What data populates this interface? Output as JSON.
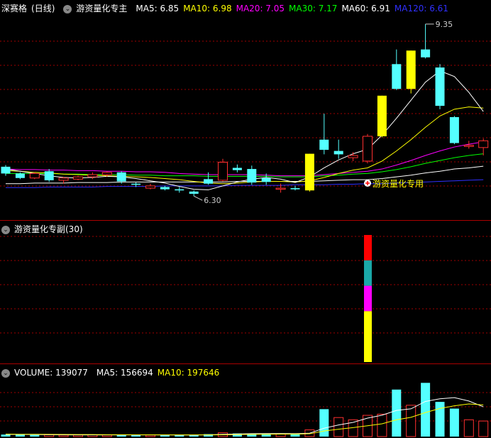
{
  "main_panel": {
    "stock_name": "深赛格",
    "period": "(日线)",
    "indicator_name": "游资量化专主",
    "ma": [
      {
        "label": "MA5: 6.85",
        "color": "#ffffff"
      },
      {
        "label": "MA10: 6.98",
        "color": "#ffff00"
      },
      {
        "label": "MA20: 7.05",
        "color": "#ff00ff"
      },
      {
        "label": "MA30: 7.17",
        "color": "#00ff00"
      },
      {
        "label": "MA60: 6.91",
        "color": "#ffffff"
      },
      {
        "label": "MA120: 6.61",
        "color": "#3030ff"
      }
    ],
    "high_label": "9.35",
    "low_label": "6.30",
    "signal_label": "游资量化专用"
  },
  "sub_panel": {
    "title": "游资量化专副(30)"
  },
  "volume_panel": {
    "volume_label": "VOLUME: 139077",
    "ma5_label": "MA5: 156694",
    "ma10_label": "MA10: 197646"
  },
  "colors": {
    "up": "#ff3030",
    "down": "#54ffff",
    "limit_up": "#ffff00",
    "grid": "#a00000"
  },
  "chart_data": {
    "type": "candlestick",
    "price_min": 6.0,
    "price_max": 9.5,
    "candles": [
      {
        "o": 6.82,
        "h": 6.85,
        "l": 6.66,
        "c": 6.7,
        "t": "down"
      },
      {
        "o": 6.7,
        "h": 6.72,
        "l": 6.6,
        "c": 6.62,
        "t": "down"
      },
      {
        "o": 6.62,
        "h": 6.72,
        "l": 6.6,
        "c": 6.7,
        "t": "up"
      },
      {
        "o": 6.74,
        "h": 6.78,
        "l": 6.55,
        "c": 6.58,
        "t": "down"
      },
      {
        "o": 6.58,
        "h": 6.64,
        "l": 6.52,
        "c": 6.62,
        "t": "up"
      },
      {
        "o": 6.6,
        "h": 6.66,
        "l": 6.58,
        "c": 6.64,
        "t": "up"
      },
      {
        "o": 6.64,
        "h": 6.72,
        "l": 6.6,
        "c": 6.68,
        "t": "up"
      },
      {
        "o": 6.68,
        "h": 6.74,
        "l": 6.64,
        "c": 6.72,
        "t": "up"
      },
      {
        "o": 6.72,
        "h": 6.74,
        "l": 6.52,
        "c": 6.56,
        "t": "down"
      },
      {
        "o": 6.52,
        "h": 6.54,
        "l": 6.46,
        "c": 6.5,
        "t": "down"
      },
      {
        "o": 6.44,
        "h": 6.52,
        "l": 6.42,
        "c": 6.48,
        "t": "up"
      },
      {
        "o": 6.46,
        "h": 6.48,
        "l": 6.4,
        "c": 6.42,
        "t": "down"
      },
      {
        "o": 6.42,
        "h": 6.46,
        "l": 6.36,
        "c": 6.4,
        "t": "down"
      },
      {
        "o": 6.38,
        "h": 6.4,
        "l": 6.3,
        "c": 6.34,
        "t": "down"
      },
      {
        "o": 6.6,
        "h": 6.72,
        "l": 6.5,
        "c": 6.52,
        "t": "down"
      },
      {
        "o": 6.58,
        "h": 6.96,
        "l": 6.56,
        "c": 6.9,
        "t": "up"
      },
      {
        "o": 6.8,
        "h": 6.86,
        "l": 6.72,
        "c": 6.76,
        "t": "down"
      },
      {
        "o": 6.78,
        "h": 6.84,
        "l": 6.5,
        "c": 6.54,
        "t": "down"
      },
      {
        "o": 6.62,
        "h": 6.7,
        "l": 6.5,
        "c": 6.55,
        "t": "down"
      },
      {
        "o": 6.42,
        "h": 6.52,
        "l": 6.36,
        "c": 6.44,
        "t": "up"
      },
      {
        "o": 6.44,
        "h": 6.48,
        "l": 6.4,
        "c": 6.42,
        "t": "down"
      },
      {
        "o": 6.4,
        "h": 7.05,
        "l": 6.38,
        "c": 7.05,
        "t": "limit"
      },
      {
        "o": 7.3,
        "h": 7.76,
        "l": 7.04,
        "c": 7.12,
        "t": "down"
      },
      {
        "o": 7.1,
        "h": 7.3,
        "l": 6.96,
        "c": 7.04,
        "t": "down"
      },
      {
        "o": 6.98,
        "h": 7.08,
        "l": 6.92,
        "c": 7.02,
        "t": "up"
      },
      {
        "o": 6.92,
        "h": 7.4,
        "l": 6.88,
        "c": 7.36,
        "t": "up"
      },
      {
        "o": 7.36,
        "h": 8.08,
        "l": 7.34,
        "c": 8.08,
        "t": "limit"
      },
      {
        "o": 8.64,
        "h": 8.9,
        "l": 8.18,
        "c": 8.2,
        "t": "down"
      },
      {
        "o": 8.2,
        "h": 8.88,
        "l": 8.12,
        "c": 8.88,
        "t": "limit"
      },
      {
        "o": 8.9,
        "h": 9.35,
        "l": 8.74,
        "c": 8.76,
        "t": "down"
      },
      {
        "o": 8.58,
        "h": 8.64,
        "l": 7.84,
        "c": 7.9,
        "t": "down"
      },
      {
        "o": 7.7,
        "h": 7.72,
        "l": 7.22,
        "c": 7.24,
        "t": "down"
      },
      {
        "o": 7.2,
        "h": 7.28,
        "l": 7.14,
        "c": 7.18,
        "t": "up"
      },
      {
        "o": 7.16,
        "h": 7.32,
        "l": 7.02,
        "c": 7.28,
        "t": "up"
      }
    ],
    "ma5": [
      6.78,
      6.74,
      6.7,
      6.66,
      6.63,
      6.62,
      6.63,
      6.65,
      6.64,
      6.61,
      6.57,
      6.53,
      6.47,
      6.42,
      6.41,
      6.48,
      6.55,
      6.6,
      6.63,
      6.6,
      6.54,
      6.64,
      6.8,
      6.94,
      7.05,
      7.13,
      7.38,
      7.68,
      8.0,
      8.32,
      8.52,
      8.42,
      8.14,
      7.8
    ],
    "ma10": [
      6.75,
      6.74,
      6.72,
      6.71,
      6.69,
      6.68,
      6.67,
      6.66,
      6.65,
      6.64,
      6.63,
      6.61,
      6.59,
      6.56,
      6.53,
      6.52,
      6.53,
      6.55,
      6.56,
      6.56,
      6.55,
      6.57,
      6.63,
      6.7,
      6.76,
      6.8,
      6.92,
      7.1,
      7.3,
      7.52,
      7.72,
      7.84,
      7.88,
      7.86
    ],
    "ma20": [
      6.78,
      6.77,
      6.77,
      6.76,
      6.76,
      6.75,
      6.75,
      6.74,
      6.74,
      6.73,
      6.73,
      6.72,
      6.7,
      6.69,
      6.68,
      6.68,
      6.68,
      6.68,
      6.67,
      6.66,
      6.66,
      6.66,
      6.68,
      6.7,
      6.72,
      6.74,
      6.78,
      6.85,
      6.93,
      7.02,
      7.1,
      7.17,
      7.22,
      7.26
    ],
    "ma30": [
      6.7,
      6.7,
      6.7,
      6.7,
      6.69,
      6.69,
      6.68,
      6.68,
      6.68,
      6.67,
      6.67,
      6.66,
      6.66,
      6.66,
      6.65,
      6.65,
      6.65,
      6.65,
      6.65,
      6.64,
      6.64,
      6.64,
      6.66,
      6.67,
      6.69,
      6.7,
      6.73,
      6.77,
      6.82,
      6.88,
      6.93,
      6.98,
      7.02,
      7.05
    ],
    "ma60": [
      6.52,
      6.52,
      6.53,
      6.53,
      6.53,
      6.54,
      6.54,
      6.54,
      6.55,
      6.55,
      6.55,
      6.55,
      6.55,
      6.55,
      6.55,
      6.55,
      6.56,
      6.56,
      6.56,
      6.56,
      6.56,
      6.56,
      6.57,
      6.58,
      6.59,
      6.59,
      6.61,
      6.64,
      6.67,
      6.71,
      6.74,
      6.78,
      6.8,
      6.83
    ],
    "ma120": [
      6.45,
      6.45,
      6.45,
      6.46,
      6.46,
      6.46,
      6.46,
      6.47,
      6.47,
      6.47,
      6.47,
      6.48,
      6.48,
      6.48,
      6.48,
      6.48,
      6.49,
      6.49,
      6.49,
      6.49,
      6.5,
      6.5,
      6.5,
      6.51,
      6.51,
      6.52,
      6.52,
      6.53,
      6.54,
      6.55,
      6.56,
      6.57,
      6.58,
      6.59
    ],
    "volume": [
      18,
      16,
      15,
      16,
      14,
      15,
      16,
      15,
      14,
      15,
      14,
      13,
      14,
      15,
      22,
      34,
      28,
      26,
      24,
      22,
      20,
      60,
      245,
      170,
      150,
      190,
      200,
      420,
      280,
      480,
      310,
      250,
      150,
      139
    ],
    "volume_type": [
      "down",
      "down",
      "down",
      "up",
      "up",
      "up",
      "up",
      "up",
      "down",
      "down",
      "up",
      "down",
      "down",
      "down",
      "down",
      "up",
      "down",
      "down",
      "down",
      "up",
      "down",
      "up",
      "down",
      "up",
      "up",
      "up",
      "up",
      "down",
      "up",
      "down",
      "down",
      "down",
      "up",
      "up"
    ],
    "vol_ma5": [
      20,
      19,
      18,
      17,
      16,
      15,
      15,
      15,
      15,
      15,
      15,
      15,
      14,
      14,
      16,
      20,
      23,
      26,
      27,
      27,
      26,
      30,
      75,
      104,
      127,
      165,
      191,
      234,
      248,
      314,
      338,
      348,
      318,
      266
    ],
    "vol_ma10": [
      22,
      21,
      21,
      20,
      19,
      18,
      18,
      17,
      17,
      16,
      16,
      15,
      15,
      15,
      15,
      16,
      18,
      20,
      21,
      22,
      22,
      25,
      50,
      66,
      80,
      97,
      114,
      150,
      172,
      215,
      251,
      275,
      292,
      283
    ],
    "volume_max": 520,
    "sub_signal": {
      "index": 25,
      "segments": [
        {
          "color": "#ff0000",
          "value": 1
        },
        {
          "color": "#1aa8a8",
          "value": 1
        },
        {
          "color": "#ff00ff",
          "value": 1
        },
        {
          "color": "#ffff00",
          "value": 2
        }
      ]
    }
  }
}
